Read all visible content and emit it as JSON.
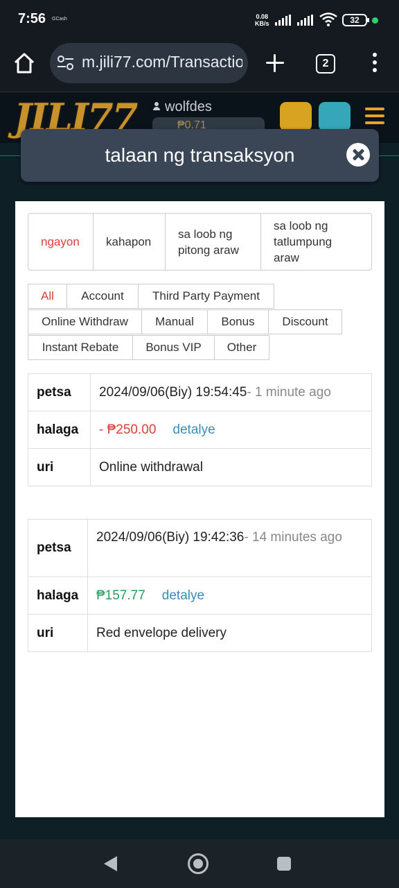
{
  "status_bar": {
    "time": "7:56",
    "gcash": "GCash",
    "speed": "0.08",
    "speed_unit": "KB/s",
    "battery": "32"
  },
  "browser": {
    "url": "m.jili77.com/Transactio",
    "tab_count": "2",
    "icons": [
      "home-icon",
      "site-settings-icon",
      "new-tab-icon",
      "tab-switcher-icon",
      "more-menu-icon"
    ]
  },
  "site_header": {
    "logo": "JILI77",
    "username": "wolfdes",
    "balance": "₱0.71"
  },
  "modal": {
    "title": "talaan ng transaksyon"
  },
  "day_tabs": [
    {
      "label": "ngayon",
      "active": true
    },
    {
      "label": "kahapon",
      "active": false
    },
    {
      "label": "sa loob ng pitong araw",
      "active": false
    },
    {
      "label": "sa loob ng tatlumpung araw",
      "active": false
    }
  ],
  "filters": [
    {
      "label": "All",
      "active": true
    },
    {
      "label": "Account"
    },
    {
      "label": "Third Party Payment"
    },
    {
      "label": "Online Withdraw"
    },
    {
      "label": "Manual"
    },
    {
      "label": "Bonus"
    },
    {
      "label": "Discount"
    },
    {
      "label": "Instant Rebate"
    },
    {
      "label": "Bonus VIP"
    },
    {
      "label": "Other"
    }
  ],
  "transactions": [
    {
      "date_label": "petsa",
      "date": "2024/09/06(Biy) 19:54:45",
      "ago": "- 1 minute ago",
      "amount_label": "halaga",
      "amount": "- ₱250.00",
      "detail": "detalye",
      "type_label": "uri",
      "type": "Online withdrawal"
    },
    {
      "date_label": "petsa",
      "date": "2024/09/06(Biy) 19:42:36",
      "ago": "- 14 minutes ago",
      "amount_label": "halaga",
      "amount": "₱157.77",
      "detail": "detalye",
      "type_label": "uri",
      "type": "Red envelope delivery"
    }
  ],
  "colors": {
    "active_red": "#d9403a",
    "positive_green": "#2a9d5c",
    "link_blue": "#3b8bba",
    "modal_bar": "#3a4656"
  }
}
